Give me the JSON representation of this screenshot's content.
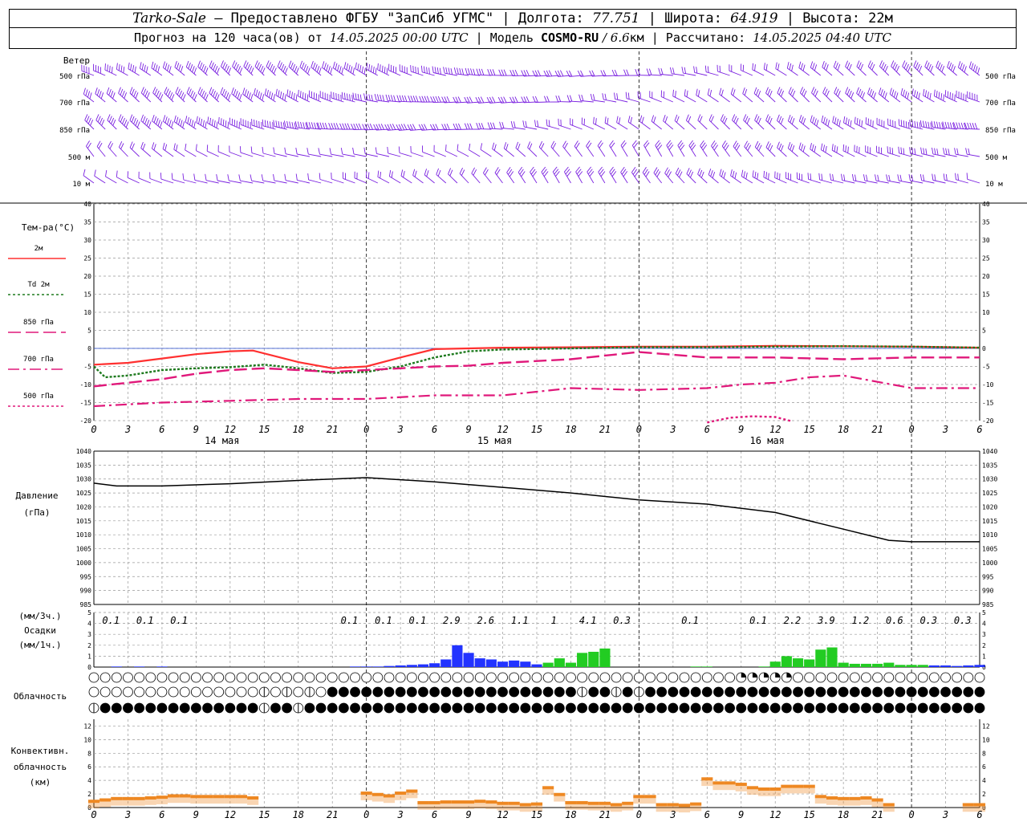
{
  "header": {
    "station": "Tarko-Sale",
    "sep1": " – Предоставлено ФГБУ \"ЗапСиб УГМС\" | Долгота: ",
    "lon": "77.751",
    "sep2": " | Широта: ",
    "lat": "64.919",
    "sep3": " | Высота: 22м",
    "line2_a": "Прогноз на 120 часа(ов) от ",
    "start": "14.05.2025 00:00 UTC",
    "line2_b": "  | Модель ",
    "model": "COSMO-RU",
    "res": " / 6.6",
    "res_unit": "км",
    "line2_c": " | Рассчитано: ",
    "calc": "14.05.2025 04:40 UTC"
  },
  "wind": {
    "title": "Ветер",
    "levels": [
      "500 гПа",
      "700 гПа",
      "850 гПа",
      "500 м",
      "10  м"
    ]
  },
  "temperature": {
    "title": "Тем-ра(°C)",
    "legend": [
      {
        "label": "2м",
        "color": "#ff3030",
        "dash": "none"
      },
      {
        "label": "Td 2м",
        "color": "#1e7a1e",
        "dash": "3,3"
      },
      {
        "label": "850 гПа",
        "color": "#e0187a",
        "dash": "16,6"
      },
      {
        "label": "700 гПа",
        "color": "#e0187a",
        "dash": "14,5,3,5"
      },
      {
        "label": "500 гПа",
        "color": "#e0187a",
        "dash": "3,3"
      }
    ],
    "yticks": [
      "40",
      "35",
      "30",
      "25",
      "20",
      "15",
      "10",
      "5",
      "0",
      "-5",
      "-10",
      "-15",
      "-20"
    ],
    "xticks": [
      "0",
      "3",
      "6",
      "9",
      "12",
      "15",
      "18",
      "21",
      "0",
      "3",
      "6",
      "9",
      "12",
      "15",
      "18",
      "21",
      "0",
      "3",
      "6",
      "9",
      "12",
      "15",
      "18",
      "21",
      "0",
      "3",
      "6"
    ],
    "days": [
      "14 мая",
      "15 мая",
      "16 мая"
    ]
  },
  "pressure": {
    "title1": "Давление",
    "title2": "(гПа)",
    "yticks": [
      "1040",
      "1035",
      "1030",
      "1025",
      "1020",
      "1015",
      "1010",
      "1005",
      "1000",
      "995",
      "990",
      "985"
    ]
  },
  "precip": {
    "title1": "(мм/3ч.)",
    "title2": "Осадки",
    "title3": "(мм/1ч.)",
    "yticks": [
      "5",
      "4",
      "3",
      "2",
      "1",
      "0"
    ],
    "totals": [
      "0.1",
      "0.1",
      "0.1",
      "0.1",
      "0.1",
      "0.1",
      "2.9",
      "2.6",
      "1.1",
      "1",
      "4.1",
      "0.3",
      "0.1",
      "0.1",
      "2.2",
      "3.9",
      "1.2",
      "0.6",
      "0.3",
      "0.3"
    ]
  },
  "cloud": {
    "title": "Облачность"
  },
  "convective": {
    "title1": "Конвективн.",
    "title2": "облачность",
    "title3": "(км)",
    "yticks": [
      "12",
      "10",
      "8",
      "6",
      "4",
      "2",
      "0"
    ]
  },
  "chart_data": [
    {
      "type": "line",
      "title": "Тем-ра(°C)",
      "x_unit": "hours from 14.05.2025 00:00 UTC",
      "ylim": [
        -20,
        40
      ],
      "series": [
        {
          "name": "2м",
          "x": [
            0,
            3,
            6,
            9,
            12,
            14,
            18,
            21,
            24,
            27,
            30,
            36,
            42,
            48,
            54,
            60,
            66,
            72,
            78
          ],
          "values": [
            -4.5,
            -4.0,
            -2.8,
            -1.6,
            -0.8,
            -0.6,
            -3.8,
            -5.5,
            -5.0,
            -2.5,
            -0.2,
            0.2,
            0.3,
            0.5,
            0.5,
            0.7,
            0.6,
            0.5,
            0.2
          ]
        },
        {
          "name": "Td 2м",
          "x": [
            0,
            1,
            3,
            6,
            9,
            12,
            15,
            18,
            21,
            24,
            27,
            30,
            33,
            36,
            42,
            48,
            54,
            60,
            66,
            72,
            78
          ],
          "values": [
            -5.0,
            -8.0,
            -7.5,
            -6.0,
            -5.5,
            -5.2,
            -4.5,
            -5.5,
            -6.8,
            -6.5,
            -5.0,
            -2.5,
            -0.8,
            -0.3,
            0.0,
            0.3,
            0.3,
            0.5,
            0.6,
            0.5,
            0.2
          ]
        },
        {
          "name": "850 гПа",
          "x": [
            0,
            3,
            6,
            9,
            12,
            15,
            18,
            21,
            24,
            27,
            30,
            33,
            36,
            42,
            48,
            54,
            60,
            66,
            72,
            78
          ],
          "values": [
            -10.5,
            -9.5,
            -8.5,
            -7.0,
            -6.0,
            -5.5,
            -6.0,
            -6.5,
            -6.0,
            -5.5,
            -5.0,
            -4.8,
            -4.0,
            -3.0,
            -1.0,
            -2.5,
            -2.5,
            -3.0,
            -2.5,
            -2.5
          ]
        },
        {
          "name": "700 гПа",
          "x": [
            0,
            6,
            12,
            18,
            24,
            30,
            36,
            39,
            42,
            48,
            54,
            57,
            60,
            63,
            66,
            72,
            78
          ],
          "values": [
            -16.0,
            -15.0,
            -14.5,
            -14.0,
            -14.0,
            -13.0,
            -13.0,
            -12.0,
            -11.0,
            -11.5,
            -11.0,
            -10.0,
            -9.5,
            -8.0,
            -7.5,
            -11.0,
            -11.0
          ]
        },
        {
          "name": "500 гПа",
          "x": [
            54,
            56,
            58,
            60,
            61.5
          ],
          "values": [
            -20.5,
            -19.2,
            -18.8,
            -19.0,
            -20.2
          ]
        }
      ]
    },
    {
      "type": "line",
      "title": "Давление (гПа)",
      "ylim": [
        985,
        1040
      ],
      "series": [
        {
          "name": "Давление",
          "x": [
            0,
            2,
            6,
            12,
            18,
            24,
            30,
            36,
            42,
            48,
            54,
            60,
            66,
            70,
            72,
            78
          ],
          "values": [
            1028.5,
            1027.5,
            1027.5,
            1028.3,
            1029.5,
            1030.5,
            1029,
            1027,
            1025,
            1022.5,
            1021,
            1018,
            1012,
            1008,
            1007.5,
            1007.5
          ]
        }
      ]
    },
    {
      "type": "bar",
      "title": "Осадки (мм/1ч.)",
      "ylim": [
        0,
        5
      ],
      "series": [
        {
          "name": "снег",
          "color": "#2233ff",
          "x": [
            2,
            4,
            6,
            23,
            24,
            25,
            26,
            27,
            28,
            29,
            30,
            31,
            32,
            33,
            34,
            35,
            36,
            37,
            38,
            39,
            74,
            75,
            76,
            77,
            78
          ],
          "values": [
            0.05,
            0.05,
            0.05,
            0.05,
            0.05,
            0.05,
            0.1,
            0.15,
            0.2,
            0.25,
            0.35,
            0.7,
            2.0,
            1.3,
            0.8,
            0.7,
            0.5,
            0.6,
            0.5,
            0.25,
            0.15,
            0.15,
            0.1,
            0.15,
            0.2
          ]
        },
        {
          "name": "дождь",
          "color": "#22cc22",
          "x": [
            40,
            41,
            42,
            43,
            44,
            45,
            53,
            54,
            59,
            60,
            61,
            62,
            63,
            64,
            65,
            66,
            67,
            68,
            69,
            70,
            71,
            72,
            73
          ],
          "values": [
            0.4,
            0.8,
            0.4,
            1.3,
            1.4,
            1.7,
            0.05,
            0.05,
            0.05,
            0.5,
            1.0,
            0.8,
            0.7,
            1.6,
            1.8,
            0.4,
            0.3,
            0.3,
            0.3,
            0.4,
            0.2,
            0.2,
            0.2
          ]
        }
      ]
    },
    {
      "type": "bar",
      "title": "Конвективн. облачность (км)",
      "ylim": [
        0,
        13
      ],
      "series": [
        {
          "name": "Конвективн.",
          "color": "#ee8822",
          "x": [
            0,
            1,
            2,
            3,
            4,
            5,
            6,
            7,
            8,
            9,
            10,
            11,
            12,
            13,
            14,
            24,
            25,
            26,
            27,
            28,
            29,
            30,
            31,
            32,
            33,
            34,
            35,
            36,
            37,
            38,
            39,
            40,
            41,
            42,
            43,
            44,
            45,
            46,
            47,
            48,
            49,
            50,
            51,
            52,
            53,
            54,
            55,
            56,
            57,
            58,
            59,
            60,
            61,
            62,
            63,
            64,
            65,
            66,
            67,
            68,
            69,
            70,
            77,
            78
          ],
          "values": [
            0.8,
            1.0,
            1.2,
            1.2,
            1.2,
            1.3,
            1.4,
            1.6,
            1.6,
            1.5,
            1.5,
            1.5,
            1.5,
            1.5,
            1.3,
            2.0,
            1.8,
            1.6,
            2.0,
            2.3,
            0.6,
            0.6,
            0.7,
            0.7,
            0.7,
            0.8,
            0.7,
            0.5,
            0.5,
            0.3,
            0.4,
            2.8,
            1.8,
            0.6,
            0.6,
            0.5,
            0.5,
            0.3,
            0.5,
            1.5,
            1.5,
            0.3,
            0.3,
            0.2,
            0.4,
            4.1,
            3.5,
            3.5,
            3.3,
            2.8,
            2.6,
            2.6,
            3.0,
            3.0,
            3.0,
            1.5,
            1.3,
            1.2,
            1.2,
            1.3,
            1.0,
            0.3,
            0.3,
            0.3
          ]
        }
      ]
    }
  ]
}
